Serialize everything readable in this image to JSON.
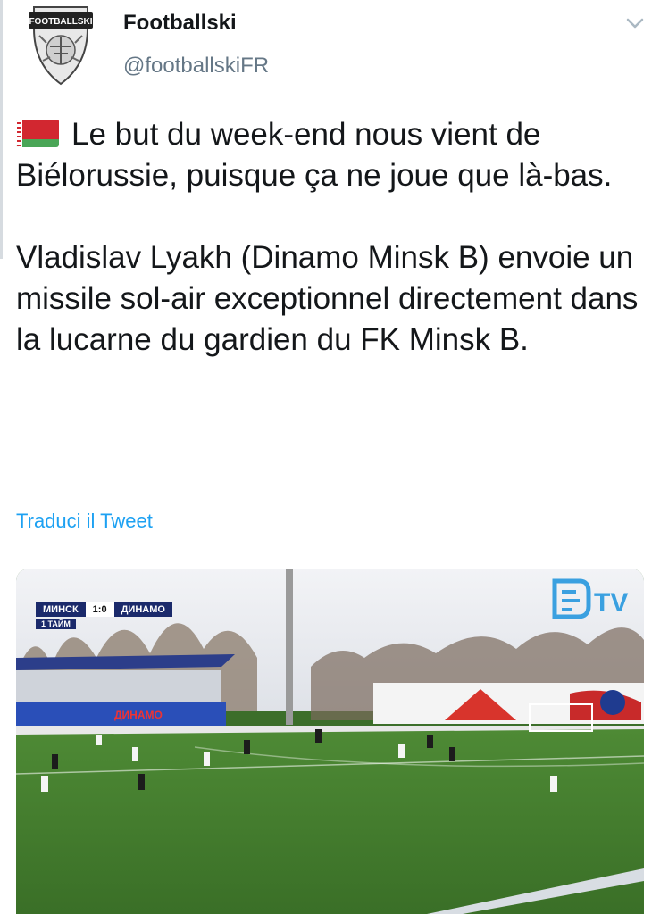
{
  "author": {
    "name": "Footballski",
    "handle": "@footballskiFR",
    "avatar_text": "FOOTBALLSKI"
  },
  "tweet": {
    "flag_icon": "belarus-flag-icon",
    "paragraph1": "Le but du week-end nous vient de Biélorussie, puisque ça ne joue que là-bas.",
    "paragraph2": "Vladislav Lyakh (Dinamo Minsk B) envoie un missile sol-air exceptionnel directement dans la lucarne du gardien du FK Minsk B."
  },
  "translate_label": "Traduci il Tweet",
  "video": {
    "home_team": "МИНСК",
    "score": "1:0",
    "away_team": "ДИНАМО",
    "period": "1 ТАЙМ",
    "channel_logo": "TV"
  },
  "colors": {
    "link": "#1da1f2",
    "secondary_text": "#657786"
  }
}
